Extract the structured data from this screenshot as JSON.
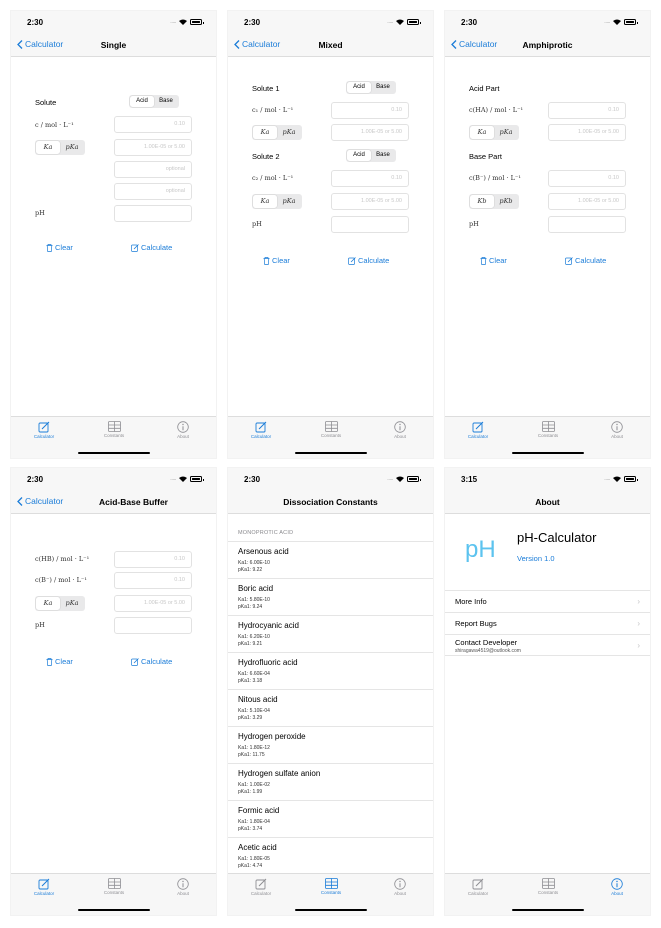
{
  "status": {
    "time_a": "2:30",
    "time_b": "3:15",
    "dots": "....."
  },
  "nav": {
    "back_label": "Calculator"
  },
  "tabs": {
    "calculator": "Calculator",
    "constants": "Constants",
    "about": "About"
  },
  "actions": {
    "clear": "Clear",
    "calculate": "Calculate"
  },
  "seg": {
    "acid": "Acid",
    "base": "Base",
    "ka": "Ka",
    "pka": "pKa",
    "kb": "Kb",
    "pkb": "pKb"
  },
  "placeholders": {
    "conc": "0.10",
    "k": "1.00E-05 or 5.00",
    "optional": "optional"
  },
  "single": {
    "title": "Single",
    "solute": "Solute",
    "c_label": "c / mol · L⁻¹",
    "ph": "pH"
  },
  "mixed": {
    "title": "Mixed",
    "solute1": "Solute 1",
    "c1_label": "c₁ / mol · L⁻¹",
    "solute2": "Solute 2",
    "c2_label": "c₂ / mol · L⁻¹",
    "ph": "pH"
  },
  "amphiprotic": {
    "title": "Amphiprotic",
    "acid_part": "Acid Part",
    "cha_label": "c(HA) / mol · L⁻¹",
    "base_part": "Base Part",
    "cb_label": "c(B⁻) / mol · L⁻¹",
    "ph": "pH"
  },
  "buffer": {
    "title": "Acid-Base Buffer",
    "chb_label": "c(HB) / mol · L⁻¹",
    "cb_label": "c(B⁻) / mol · L⁻¹",
    "ph": "pH"
  },
  "constants": {
    "title": "Dissociation Constants",
    "section": "MONOPROTIC ACID",
    "acids": [
      {
        "name": "Arsenous acid",
        "ka": "Ka1: 6.00E-10",
        "pka": "pKa1: 9.22"
      },
      {
        "name": "Boric acid",
        "ka": "Ka1: 5.80E-10",
        "pka": "pKa1: 9.24"
      },
      {
        "name": "Hydrocyanic acid",
        "ka": "Ka1: 6.20E-10",
        "pka": "pKa1: 9.21"
      },
      {
        "name": "Hydrofluoric acid",
        "ka": "Ka1: 6.60E-04",
        "pka": "pKa1: 3.18"
      },
      {
        "name": "Nitous acid",
        "ka": "Ka1: 5.10E-04",
        "pka": "pKa1: 3.29"
      },
      {
        "name": "Hydrogen peroxide",
        "ka": "Ka1: 1.80E-12",
        "pka": "pKa1: 11.75"
      },
      {
        "name": "Hydrogen sulfate anion",
        "ka": "Ka1: 1.00E-02",
        "pka": "pKa1: 1.99"
      },
      {
        "name": "Formic acid",
        "ka": "Ka1: 1.80E-04",
        "pka": "pKa1: 3.74"
      },
      {
        "name": "Acetic acid",
        "ka": "Ka1: 1.80E-05",
        "pka": "pKa1: 4.74"
      }
    ]
  },
  "about": {
    "title": "About",
    "logo": "pH",
    "app_name": "pH-Calculator",
    "version": "Version 1.0",
    "more_info": "More Info",
    "report_bugs": "Report Bugs",
    "contact": "Contact Developer",
    "email": "shiragawa4519@outlook.com"
  }
}
